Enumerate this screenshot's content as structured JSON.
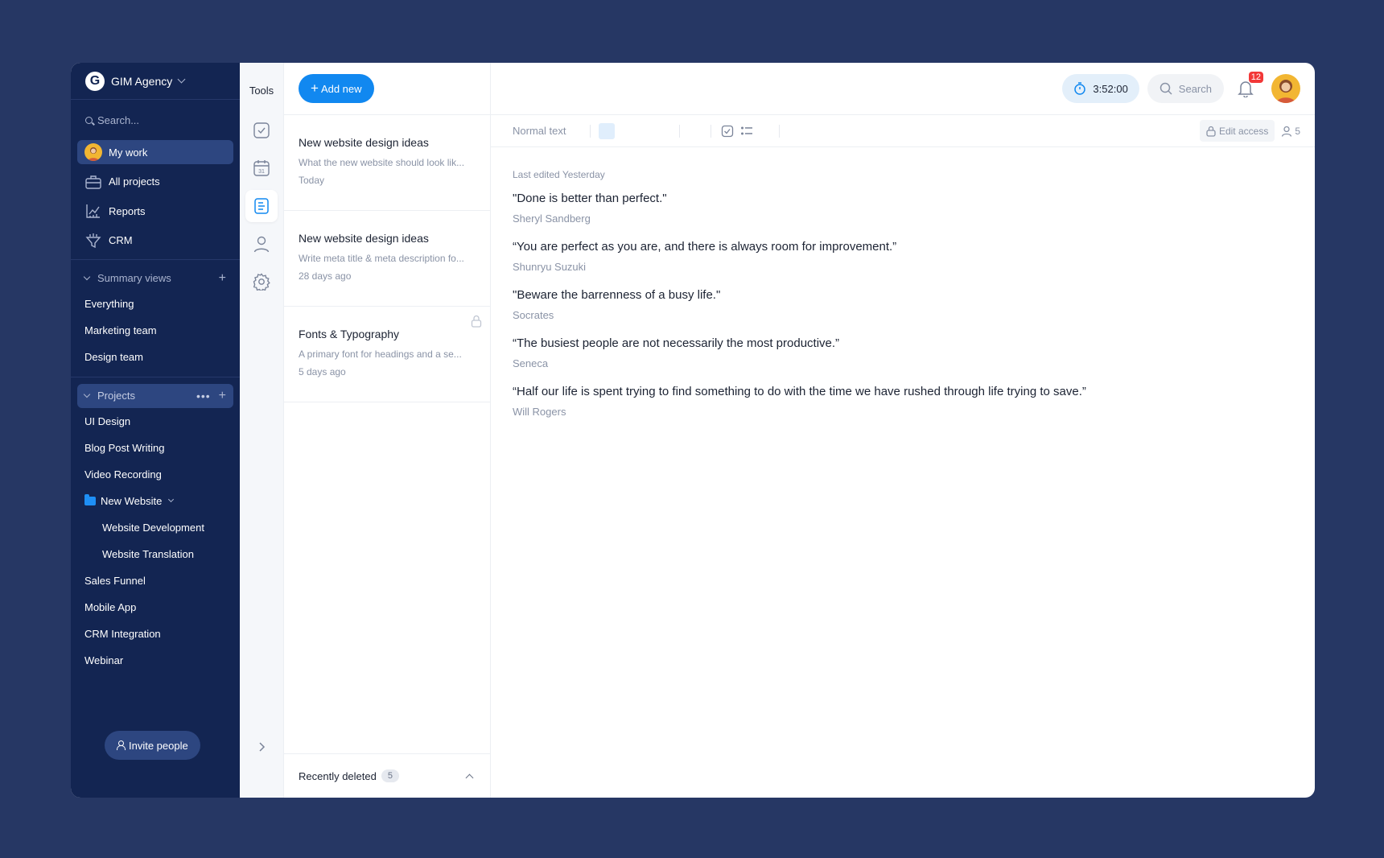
{
  "workspace": {
    "logo_letter": "G",
    "name": "GIM Agency"
  },
  "sidebar": {
    "search_placeholder": "Search...",
    "nav": [
      {
        "label": "My work",
        "icon": "avatar"
      },
      {
        "label": "All projects",
        "icon": "briefcase-icon"
      },
      {
        "label": "Reports",
        "icon": "chart-icon"
      },
      {
        "label": "CRM",
        "icon": "funnel-icon"
      }
    ],
    "summary_title": "Summary views",
    "summary_items": [
      "Everything",
      "Marketing team",
      "Design team"
    ],
    "projects_title": "Projects",
    "projects": {
      "ui_design": "UI Design",
      "blog": "Blog Post Writing",
      "video": "Video Recording",
      "new_website": "New Website",
      "web_dev": "Website Development",
      "web_trans": "Website Translation",
      "sales": "Sales Funnel",
      "mobile": "Mobile App",
      "crm_int": "CRM Integration",
      "webinar": "Webinar"
    },
    "invite_label": "Invite people"
  },
  "tools": {
    "title": "Tools"
  },
  "notes": {
    "add_label": "Add new",
    "items": [
      {
        "title": "New website design ideas",
        "preview": "What the new website should look lik...",
        "date": "Today"
      },
      {
        "title": "New website design ideas",
        "preview": "Write meta title & meta description fo...",
        "date": "28 days ago"
      },
      {
        "title": "Fonts & Typography",
        "preview": "A primary font for headings and a se...",
        "date": "5 days ago"
      }
    ],
    "deleted_label": "Recently deleted",
    "deleted_count": "5"
  },
  "topbar": {
    "timer": "3:52:00",
    "search_placeholder": "Search",
    "notifications": "12"
  },
  "editor": {
    "text_style": "Normal text",
    "edit_access": "Edit access",
    "collaborators": "5",
    "last_edited": "Last edited Yesterday",
    "quotes": [
      {
        "text": "\"Done is better than perfect.\"",
        "author": "Sheryl Sandberg"
      },
      {
        "text": "“You are perfect as you are, and there is always room for improvement.”",
        "author": "Shunryu Suzuki"
      },
      {
        "text": "\"Beware the barrenness of a busy life.\"",
        "author": "Socrates"
      },
      {
        "text": "“The busiest people are not necessarily the most productive.”",
        "author": "Seneca"
      },
      {
        "text": "“Half our life is spent trying to find something to do with the time we have rushed through life trying to save.”",
        "author": "Will Rogers"
      }
    ]
  },
  "colors": {
    "accent": "#1188f0",
    "sidebar_bg": "#132552",
    "page_bg": "#263764",
    "badge_red": "#f23838"
  }
}
